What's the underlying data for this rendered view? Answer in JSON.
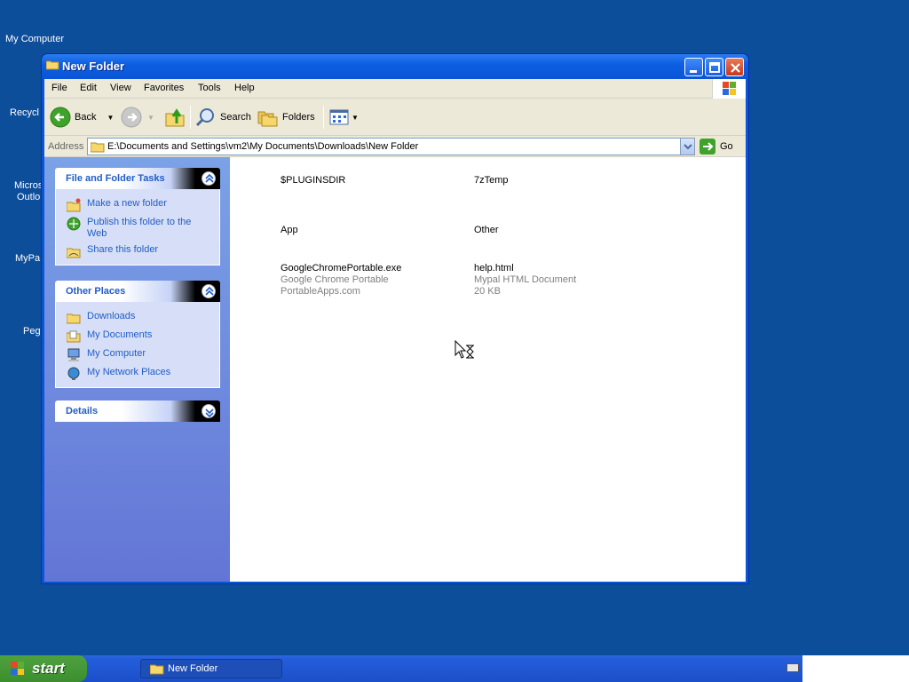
{
  "desktop": {
    "icons": [
      "My Computer",
      "Recycl",
      "Micros",
      "Outlo",
      "MyPa",
      "Peg"
    ]
  },
  "window": {
    "title": "New Folder",
    "menu": [
      "File",
      "Edit",
      "View",
      "Favorites",
      "Tools",
      "Help"
    ],
    "toolbar": {
      "back": "Back",
      "search": "Search",
      "folders": "Folders"
    },
    "address": {
      "label": "Address",
      "value": "E:\\Documents and Settings\\vm2\\My Documents\\Downloads\\New Folder",
      "go": "Go"
    },
    "tasks": {
      "file_folder": {
        "title": "File and Folder Tasks",
        "items": [
          "Make a new folder",
          "Publish this folder to the Web",
          "Share this folder"
        ]
      },
      "other_places": {
        "title": "Other Places",
        "items": [
          "Downloads",
          "My Documents",
          "My Computer",
          "My Network Places"
        ]
      },
      "details": {
        "title": "Details"
      }
    },
    "files": [
      {
        "name": "$PLUGINSDIR",
        "line2": "",
        "line3": ""
      },
      {
        "name": "7zTemp",
        "line2": "",
        "line3": ""
      },
      {
        "name": "App",
        "line2": "",
        "line3": ""
      },
      {
        "name": "Other",
        "line2": "",
        "line3": ""
      },
      {
        "name": "GoogleChromePortable.exe",
        "line2": "Google Chrome Portable",
        "line3": "PortableApps.com"
      },
      {
        "name": "help.html",
        "line2": "Mypal HTML Document",
        "line3": "20 KB"
      }
    ]
  },
  "taskbar": {
    "start": "start",
    "task": "New Folder"
  }
}
